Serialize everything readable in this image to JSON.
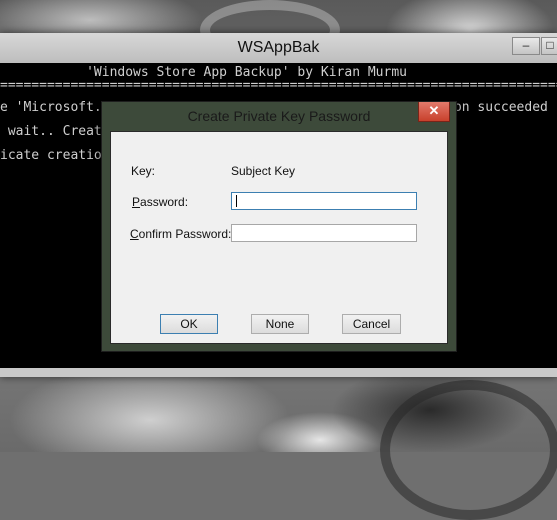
{
  "console": {
    "title": "WSAppBak",
    "lines": [
      "           'Windows Store App Backup' by Kiran Murmu",
      "=========================================================================",
      "e 'Microsoft.                                           tion succeeded",
      " wait.. Creat",
      "icate creatio"
    ],
    "minimize_glyph": "–",
    "maximize_glyph": "□"
  },
  "dialog": {
    "title": "Create Private Key Password",
    "close_glyph": "✕",
    "key_label": "Key:",
    "key_value": "Subject Key",
    "password_label_first": "P",
    "password_label_rest": "assword:",
    "password_value": "",
    "confirm_label_first": "C",
    "confirm_label_rest": "onfirm Password:",
    "confirm_value": "",
    "ok_label": "OK",
    "none_label": "None",
    "cancel_label": "Cancel"
  }
}
